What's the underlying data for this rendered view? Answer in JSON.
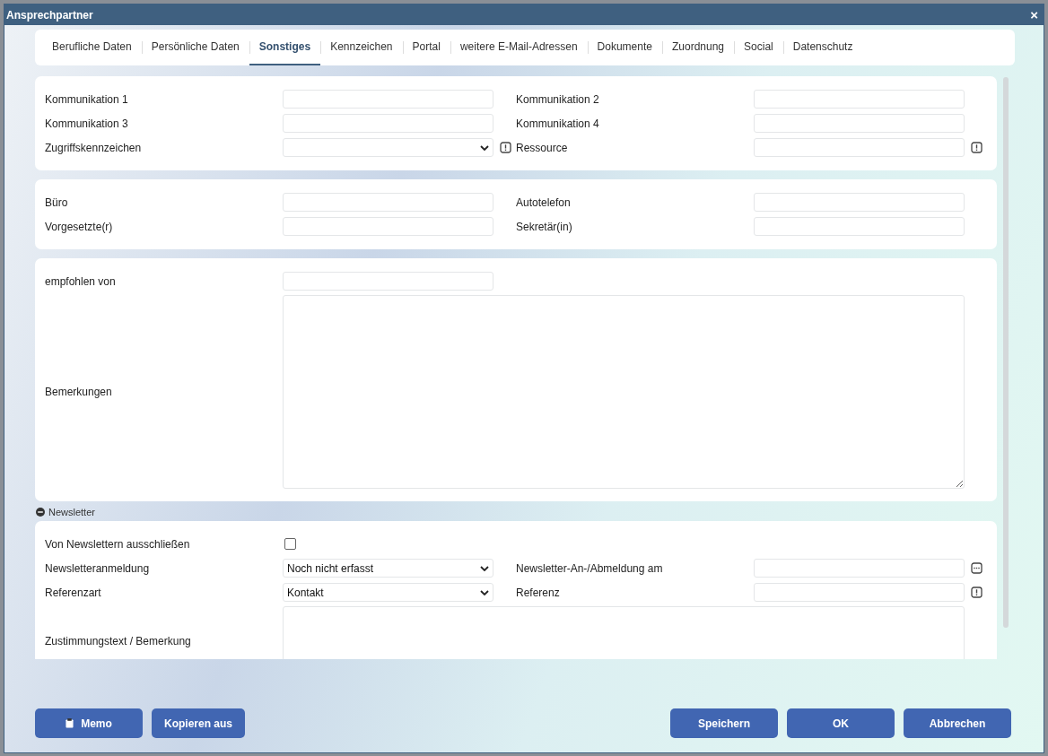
{
  "window": {
    "title": "Ansprechpartner",
    "close": "×"
  },
  "tabs": [
    {
      "label": "Berufliche Daten",
      "selected": false
    },
    {
      "label": "Persönliche Daten",
      "selected": false
    },
    {
      "label": "Sonstiges",
      "selected": true
    },
    {
      "label": "Kennzeichen",
      "selected": false
    },
    {
      "label": "Portal",
      "selected": false
    },
    {
      "label": "weitere E-Mail-Adressen",
      "selected": false
    },
    {
      "label": "Dokumente",
      "selected": false
    },
    {
      "label": "Zuordnung",
      "selected": false
    },
    {
      "label": "Social",
      "selected": false
    },
    {
      "label": "Datenschutz",
      "selected": false
    }
  ],
  "sections": [
    {
      "rows": [
        {
          "fields": [
            {
              "label": "Kommunikation 1",
              "kind": "text"
            },
            {
              "label": "Kommunikation 2",
              "kind": "text"
            }
          ]
        },
        {
          "fields": [
            {
              "label": "Kommunikation 3",
              "kind": "text"
            },
            {
              "label": "Kommunikation 4",
              "kind": "text"
            }
          ]
        },
        {
          "fields": [
            {
              "label": "Zugriffskennzeichen",
              "kind": "select",
              "addon": {
                "kind": "alert"
              }
            },
            {
              "label": "Ressource",
              "kind": "text",
              "addon": {
                "kind": "alert"
              }
            }
          ]
        }
      ]
    },
    {
      "rows": [
        {
          "fields": [
            {
              "label": "Büro",
              "kind": "text"
            },
            {
              "label": "Autotelefon",
              "kind": "text"
            }
          ]
        },
        {
          "fields": [
            {
              "label": "Vorgesetzte(r)",
              "kind": "text"
            },
            {
              "label": "Sekretär(in)",
              "kind": "text"
            }
          ]
        }
      ]
    },
    {
      "rows": [
        {
          "fields": [
            {
              "label": "empfohlen von",
              "kind": "text"
            }
          ]
        },
        {
          "fields": [
            {
              "label": "Bemerkungen",
              "kind": "textarea"
            }
          ]
        }
      ]
    },
    {
      "header": {
        "label": "Newsletter",
        "expanded": true
      },
      "rows": [
        {
          "fields": [
            {
              "label": "Von Newslettern ausschließen",
              "kind": "checkbox",
              "checked": false
            }
          ]
        },
        {
          "fields": [
            {
              "label": "Newsletteranmeldung",
              "kind": "select",
              "value": "Noch nicht erfasst"
            },
            {
              "label": "Newsletter-An-/Abmeldung am",
              "kind": "text",
              "addon": {
                "kind": "more"
              }
            }
          ]
        },
        {
          "fields": [
            {
              "label": "Referenzart",
              "kind": "select",
              "value": "Kontakt"
            },
            {
              "label": "Referenz",
              "kind": "text",
              "addon": {
                "kind": "alert"
              }
            }
          ]
        },
        {
          "fields": [
            {
              "label": "Zustimmungstext / Bemerkung",
              "kind": "textarea"
            }
          ]
        }
      ]
    }
  ],
  "buttons_left": [
    {
      "label": "Memo",
      "kind": "memo"
    },
    {
      "label": "Kopieren aus",
      "kind": "plain"
    }
  ],
  "buttons_right": [
    {
      "label": "Speichern"
    },
    {
      "label": "OK"
    },
    {
      "label": "Abbrechen"
    }
  ]
}
